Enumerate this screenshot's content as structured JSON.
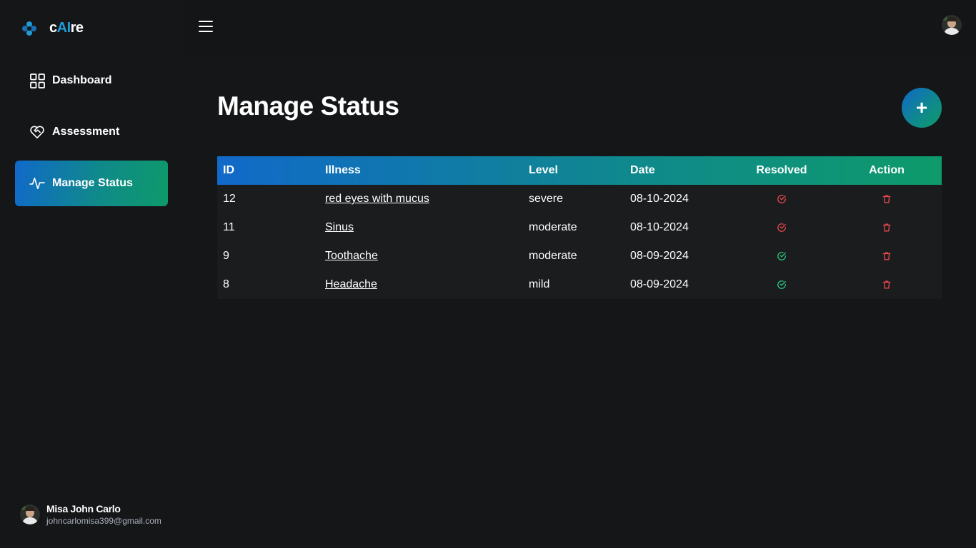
{
  "brand": {
    "prefix": "c",
    "ai": "AI",
    "suffix": "re",
    "accent": "#1f9bd6"
  },
  "sidebar": {
    "items": [
      {
        "label": "Dashboard",
        "icon": "grid-icon",
        "active": false
      },
      {
        "label": "Assessment",
        "icon": "heart-handshake-icon",
        "active": false
      },
      {
        "label": "Manage Status",
        "icon": "activity-icon",
        "active": true
      }
    ]
  },
  "user": {
    "name": "Misa John Carlo",
    "email": "johncarlomisa399@gmail.com"
  },
  "page": {
    "title": "Manage Status",
    "add_label": "+"
  },
  "table": {
    "headers": [
      "ID",
      "Illness",
      "Level",
      "Date",
      "Resolved",
      "Action"
    ],
    "rows": [
      {
        "id": "12",
        "illness": "red eyes with mucus",
        "level": "severe",
        "date": "08-10-2024",
        "resolved": false
      },
      {
        "id": "11",
        "illness": "Sinus",
        "level": "moderate",
        "date": "08-10-2024",
        "resolved": false
      },
      {
        "id": "9",
        "illness": "Toothache",
        "level": "moderate",
        "date": "08-09-2024",
        "resolved": true
      },
      {
        "id": "8",
        "illness": "Headache",
        "level": "mild",
        "date": "08-09-2024",
        "resolved": true
      }
    ]
  },
  "colors": {
    "background": "#151618",
    "gradient_start": "#1169c9",
    "gradient_end": "#0e9a6a",
    "resolved_true": "#2ec27e",
    "resolved_false": "#e5484d",
    "delete": "#e5484d"
  }
}
